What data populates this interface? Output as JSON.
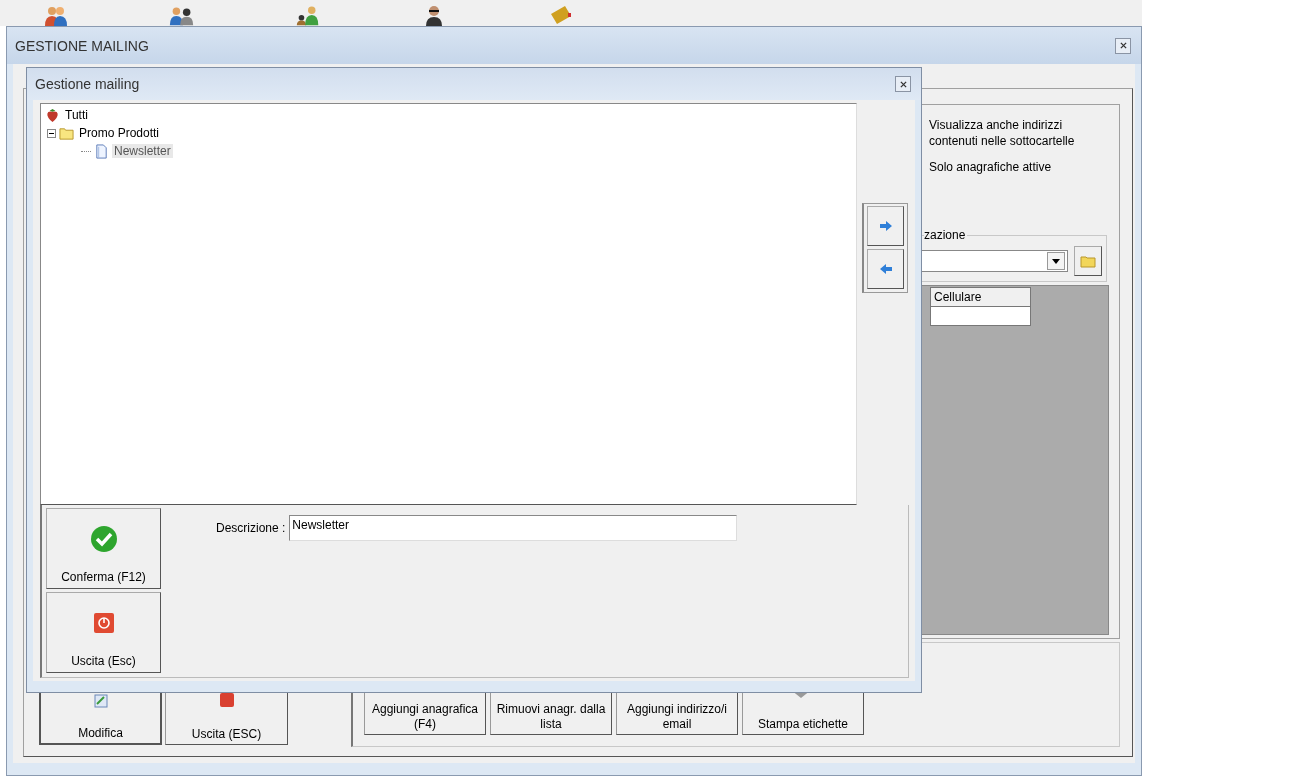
{
  "window": {
    "title": "GESTIONE MAILING"
  },
  "options": [
    {
      "label": "Visualizza anche indirizzi contenuti nelle sottocartelle"
    },
    {
      "label": "Solo anagrafiche attive"
    }
  ],
  "group_label": "zazione",
  "grid": {
    "columns": [
      "Cellulare"
    ]
  },
  "left_buttons": [
    {
      "label": "Modifica",
      "kind": "edit"
    },
    {
      "label": "Uscita (ESC)",
      "kind": "exit"
    }
  ],
  "action_buttons": [
    {
      "label": "Aggiungi anagrafica (F4)",
      "kind": "text"
    },
    {
      "label": "Rimuovi anagr. dalla lista",
      "kind": "text"
    },
    {
      "label": "Aggiungi indirizzo/i email",
      "kind": "text"
    },
    {
      "label": "Stampa etichette",
      "kind": "print"
    }
  ],
  "dialog": {
    "title": "Gestione mailing",
    "tree": [
      {
        "label": "Tutti",
        "kind": "root",
        "selected": false,
        "children": [
          {
            "label": "Promo Prodotti",
            "kind": "folder",
            "selected": false,
            "expanded": true,
            "children": [
              {
                "label": "Newsletter",
                "kind": "document",
                "selected": true
              }
            ]
          }
        ]
      }
    ],
    "description": {
      "label": "Descrizione :",
      "value": "Newsletter"
    },
    "buttons": [
      {
        "label": "Conferma (F12)",
        "kind": "confirm"
      },
      {
        "label": "Uscita (Esc)",
        "kind": "exit"
      }
    ]
  }
}
